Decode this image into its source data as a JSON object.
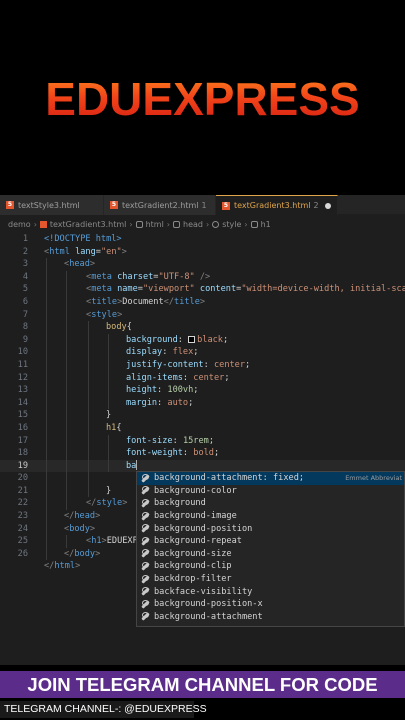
{
  "banner": {
    "title": "EDUEXPRESS"
  },
  "tabs": [
    {
      "label": "textStyle3.html",
      "extra": "",
      "active": false
    },
    {
      "label": "textGradient2.html",
      "extra": "1",
      "active": false
    },
    {
      "label": "textGradient3.html",
      "extra": "2",
      "active": true
    }
  ],
  "breadcrumb": [
    "demo",
    "textGradient3.html",
    "html",
    "head",
    "style",
    "h1"
  ],
  "code": {
    "line_numbers": [
      "1",
      "2",
      "3",
      "4",
      "5",
      "6",
      "7",
      "8",
      "9",
      "10",
      "11",
      "12",
      "13",
      "14",
      "15",
      "16",
      "17",
      "18",
      "19",
      "20",
      "21",
      "22",
      "23",
      "24",
      "25",
      "26"
    ],
    "l1_doctype": "<!DOCTYPE html>",
    "l2_open": "<",
    "l2_tag": "html",
    "l2_attr": "lang",
    "l2_eq": "=",
    "l2_str": "\"en\"",
    "l2_close": ">",
    "l3_open": "<",
    "l3_tag": "head",
    "l3_close": ">",
    "l4_open": "<",
    "l4_tag": "meta",
    "l4_attr": "charset",
    "l4_eq": "=",
    "l4_str": "\"UTF-8\"",
    "l4_close": " />",
    "l5_open": "<",
    "l5_tag": "meta",
    "l5_attr1": "name",
    "l5_eq1": "=",
    "l5_str1": "\"viewport\"",
    "l5_attr2": "content",
    "l5_eq2": "=",
    "l5_str2": "\"width=device-width, initial-scal",
    "l6_open": "<",
    "l6_tag": "title",
    "l6_mid": ">",
    "l6_text": "Document",
    "l6_end_open": "</",
    "l6_end_tag": "title",
    "l6_close": ">",
    "l7_open": "<",
    "l7_tag": "style",
    "l7_close": ">",
    "l8_sel": "body",
    "l8_brace": "{",
    "l9_prop": "background",
    "l9_colon": ": ",
    "l9_val": "black",
    "l9_semi": ";",
    "l10_prop": "display",
    "l10_colon": ": ",
    "l10_val": "flex",
    "l10_semi": ";",
    "l11_prop": "justify-content",
    "l11_colon": ": ",
    "l11_val": "center",
    "l11_semi": ";",
    "l12_prop": "align-items",
    "l12_colon": ": ",
    "l12_val": "center",
    "l12_semi": ";",
    "l13_prop": "height",
    "l13_colon": ": ",
    "l13_val": "100vh",
    "l13_semi": ";",
    "l14_prop": "margin",
    "l14_colon": ": ",
    "l14_val": "auto",
    "l14_semi": ";",
    "l15_brace": "}",
    "l16_sel": "h1",
    "l16_brace": "{",
    "l17_prop": "font-size",
    "l17_colon": ": ",
    "l17_val": "15rem",
    "l17_semi": ";",
    "l18_prop": "font-weight",
    "l18_colon": ": ",
    "l18_val": "bold",
    "l18_semi": ";",
    "l19_typed": "ba",
    "l21_brace": "}",
    "l22_open": "</",
    "l22_tag": "style",
    "l22_close": ">",
    "l23_open": "</",
    "l23_tag": "head",
    "l23_close": ">",
    "l24_open": "<",
    "l24_tag": "body",
    "l24_close": ">",
    "l25_open": "<",
    "l25_tag": "h1",
    "l25_mid": ">",
    "l25_text": "EDUEXP",
    "l26_open": "</",
    "l26_tag": "body",
    "l26_close": ">",
    "l27_open": "</",
    "l27_tag": "html",
    "l27_close": ">"
  },
  "suggestions": {
    "items": [
      {
        "label": "background-attachment: fixed;",
        "detail": "Emmet Abbreviat"
      },
      {
        "label": "background-color"
      },
      {
        "label": "background"
      },
      {
        "label": "background-image"
      },
      {
        "label": "background-position"
      },
      {
        "label": "background-repeat"
      },
      {
        "label": "background-size"
      },
      {
        "label": "background-clip"
      },
      {
        "label": "backdrop-filter"
      },
      {
        "label": "backface-visibility"
      },
      {
        "label": "background-position-x"
      },
      {
        "label": "background-attachment"
      }
    ]
  },
  "footer": {
    "title": "JOIN TELEGRAM CHANNEL FOR CODE",
    "subtitle": "TELEGRAM CHANNEL-: @EDUEXPRESS"
  }
}
